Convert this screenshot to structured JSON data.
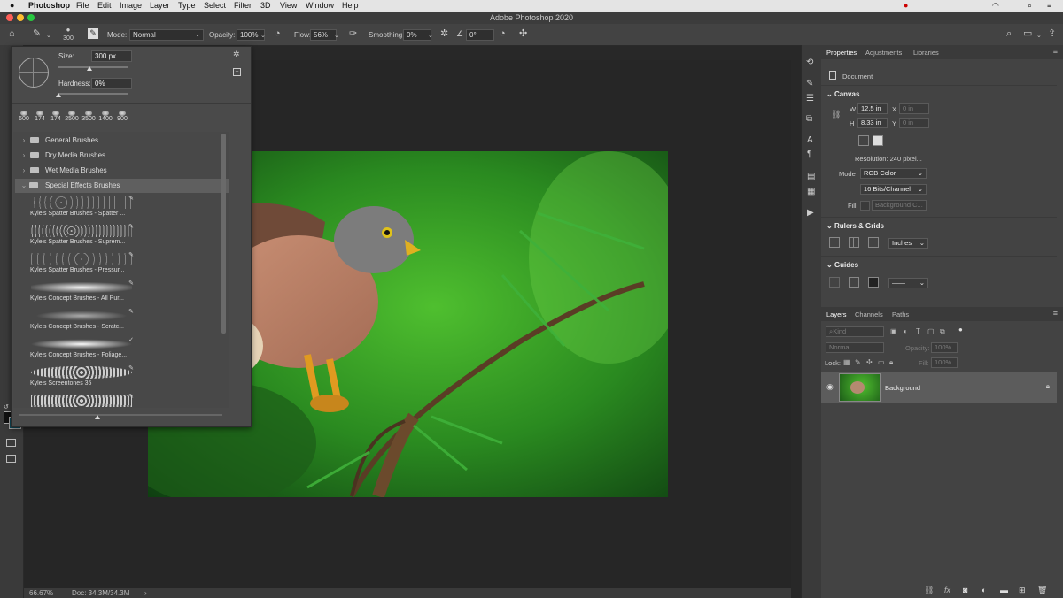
{
  "menubar": {
    "app": "Photoshop",
    "items": [
      "File",
      "Edit",
      "Image",
      "Layer",
      "Type",
      "Select",
      "Filter",
      "3D",
      "View",
      "Window",
      "Help"
    ]
  },
  "window": {
    "title": "Adobe Photoshop 2020"
  },
  "options_bar": {
    "brush_size": "300",
    "mode_label": "Mode:",
    "mode_value": "Normal",
    "opacity_label": "Opacity:",
    "opacity_value": "100%",
    "flow_label": "Flow:",
    "flow_value": "56%",
    "smoothing_label": "Smoothing:",
    "smoothing_value": "0%",
    "angle_value": "0°"
  },
  "brush_panel": {
    "size_label": "Size:",
    "size_value": "300 px",
    "size_level": 0.45,
    "hardness_label": "Hardness:",
    "hardness_value": "0%",
    "hardness_level": 0.0,
    "presets": [
      "600",
      "174",
      "174",
      "2500",
      "3500",
      "1400",
      "900"
    ],
    "folders": [
      {
        "name": "General Brushes",
        "open": false
      },
      {
        "name": "Dry Media Brushes",
        "open": false
      },
      {
        "name": "Wet Media Brushes",
        "open": false
      },
      {
        "name": "Special Effects Brushes",
        "open": true
      }
    ],
    "brushes": [
      "Kyle's Spatter Brushes - Spatter ...",
      "Kyle's Spatter Brushes - Suprem...",
      "Kyle's Spatter Brushes - Pressur...",
      "Kyle's Concept Brushes - All Pur...",
      "Kyle's Concept Brushes - Scratc...",
      "Kyle's Concept Brushes - Foliage...",
      "Kyle's Screentones 35"
    ]
  },
  "status_bar": {
    "zoom": "66.67%",
    "doc": "Doc: 34.3M/34.3M"
  },
  "right_panel": {
    "tabs": [
      "Properties",
      "Adjustments",
      "Libraries"
    ],
    "document_label": "Document",
    "canvas": {
      "title": "Canvas",
      "w_label": "W",
      "w_value": "12.5 in",
      "h_label": "H",
      "h_value": "8.33 in",
      "x_label": "X",
      "y_label": "Y",
      "x_value": "0 in",
      "y_value": "0 in",
      "resolution": "Resolution: 240 pixel...",
      "mode_label": "Mode",
      "mode_value": "RGB Color",
      "bits_value": "16 Bits/Channel",
      "fill_label": "Fill",
      "fill_value": "Background C..."
    },
    "rulers": {
      "title": "Rulers & Grids",
      "units": "Inches"
    },
    "guides": {
      "title": "Guides"
    },
    "layers_tabs": [
      "Layers",
      "Channels",
      "Paths"
    ],
    "layers": {
      "kind_placeholder": "Kind",
      "blend_mode": "Normal",
      "opacity_label": "Opacity:",
      "opacity_value": "100%",
      "lock_label": "Lock:",
      "fill_label": "Fill:",
      "fill_value": "100%",
      "items": [
        {
          "name": "Background"
        }
      ]
    }
  },
  "colors": {
    "accent": "#1473e6",
    "panel": "#434343",
    "canvas_bg": "#282828"
  }
}
